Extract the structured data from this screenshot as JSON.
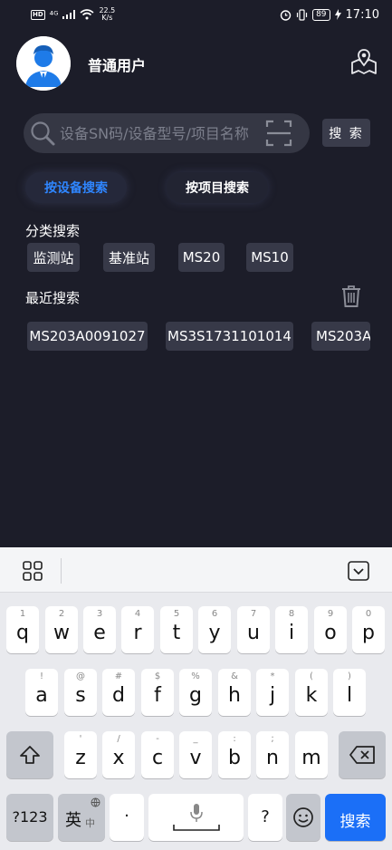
{
  "status_bar": {
    "hd": "HD",
    "signal": "⁴ᴳ",
    "net_speed_value": "22.5",
    "net_speed_unit": "K/s",
    "battery": "89",
    "time": "17:10"
  },
  "header": {
    "username": "普通用户"
  },
  "search": {
    "placeholder": "设备SN码/设备型号/项目名称",
    "button_label": "搜 索"
  },
  "mode_tabs": [
    {
      "label": "按设备搜索",
      "selected": true
    },
    {
      "label": "按项目搜索",
      "selected": false
    }
  ],
  "category": {
    "title": "分类搜索",
    "chips": [
      "监测站",
      "基准站",
      "MS20",
      "MS10"
    ]
  },
  "recent": {
    "title": "最近搜索",
    "chips": [
      "MS203A0091027",
      "MS3S1731101014",
      "MS203A"
    ]
  },
  "colors": {
    "background": "#1c1d29",
    "accent": "#2f86ff",
    "chip": "#373948",
    "keyboard_action": "#1b6ff7"
  },
  "keyboard": {
    "row1": [
      {
        "hint": "1",
        "key": "q"
      },
      {
        "hint": "2",
        "key": "w"
      },
      {
        "hint": "3",
        "key": "e"
      },
      {
        "hint": "4",
        "key": "r"
      },
      {
        "hint": "5",
        "key": "t"
      },
      {
        "hint": "6",
        "key": "y"
      },
      {
        "hint": "7",
        "key": "u"
      },
      {
        "hint": "8",
        "key": "i"
      },
      {
        "hint": "9",
        "key": "o"
      },
      {
        "hint": "0",
        "key": "p"
      }
    ],
    "row2": [
      {
        "hint": "!",
        "key": "a"
      },
      {
        "hint": "@",
        "key": "s"
      },
      {
        "hint": "#",
        "key": "d"
      },
      {
        "hint": "$",
        "key": "f"
      },
      {
        "hint": "%",
        "key": "g"
      },
      {
        "hint": "&",
        "key": "h"
      },
      {
        "hint": "*",
        "key": "j"
      },
      {
        "hint": "(",
        "key": "k"
      },
      {
        "hint": ")",
        "key": "l"
      }
    ],
    "row3": [
      {
        "hint": "'",
        "key": "z"
      },
      {
        "hint": "/",
        "key": "x"
      },
      {
        "hint": "-",
        "key": "c"
      },
      {
        "hint": "_",
        "key": "v"
      },
      {
        "hint": ":",
        "key": "b"
      },
      {
        "hint": ";",
        "key": "n"
      },
      {
        "hint": "",
        "key": "m"
      }
    ],
    "shift_icon": "shift-icon",
    "delete_icon": "backspace-icon",
    "symbols_label": "?123",
    "lang_label": "英",
    "lang_sub": "中",
    "dot_label": "·",
    "question_label": "?",
    "emoji_icon": "emoji-icon",
    "action_label": "搜索"
  }
}
